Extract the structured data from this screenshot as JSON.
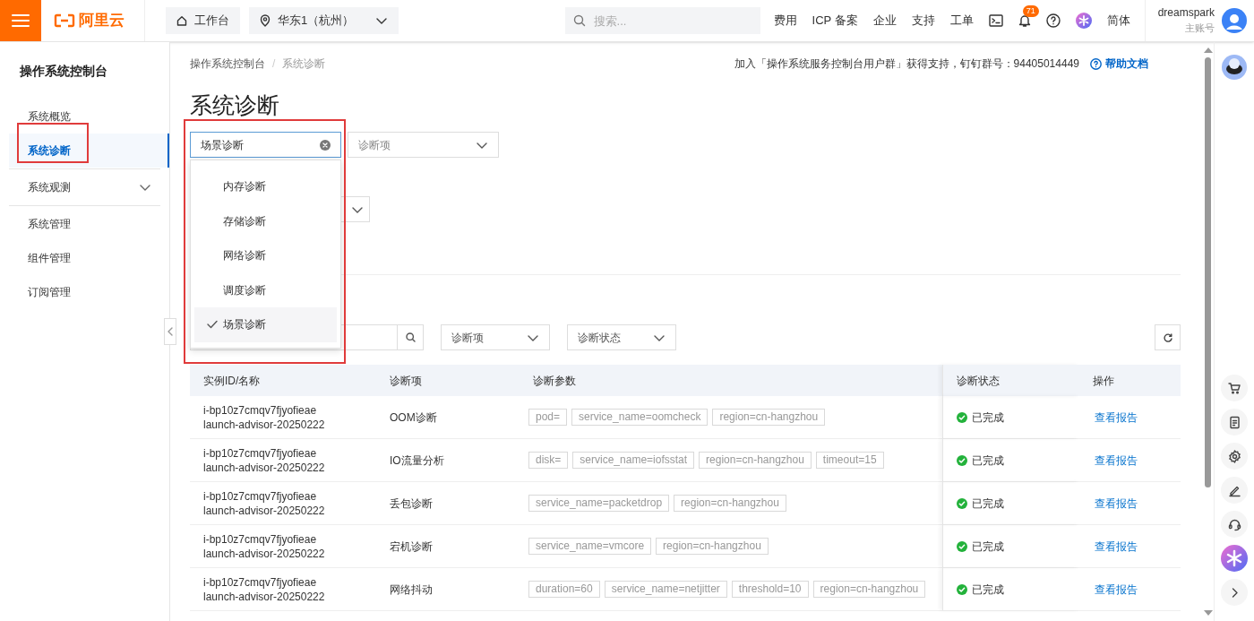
{
  "topbar": {
    "logo_text": "阿里云",
    "workbench": "工作台",
    "region": "华东1（杭州）",
    "search_placeholder": "搜索...",
    "links": [
      "费用",
      "ICP 备案",
      "企业",
      "支持",
      "工单"
    ],
    "notification_count": "71",
    "language": "简体",
    "user": {
      "name": "dreamspark",
      "role": "主账号"
    }
  },
  "sidebar": {
    "title": "操作系统控制台",
    "groups": [
      {
        "items": [
          {
            "label": "系统概览",
            "kind": "link",
            "selected": false
          },
          {
            "label": "系统诊断",
            "kind": "link",
            "selected": true
          }
        ]
      },
      {
        "items": [
          {
            "label": "系统观测",
            "kind": "group",
            "selected": false
          }
        ]
      },
      {
        "items": [
          {
            "label": "系统管理",
            "kind": "link",
            "selected": false
          },
          {
            "label": "组件管理",
            "kind": "link",
            "selected": false
          },
          {
            "label": "订阅管理",
            "kind": "link",
            "selected": false
          }
        ]
      }
    ]
  },
  "breadcrumb": [
    "操作系统控制台",
    "系统诊断"
  ],
  "breadcrumb_separator": "/",
  "notice": "加入「操作系统服务控制台用户群」获得支持，钉钉群号：94405014449",
  "help_link": "帮助文档",
  "page_title": "系统诊断",
  "filters": {
    "category": {
      "value": "场景诊断"
    },
    "item": {
      "placeholder": "诊断项"
    }
  },
  "dropdown": {
    "options": [
      {
        "label": "内存诊断",
        "selected": false
      },
      {
        "label": "存储诊断",
        "selected": false
      },
      {
        "label": "网络诊断",
        "selected": false
      },
      {
        "label": "调度诊断",
        "selected": false
      },
      {
        "label": "场景诊断",
        "selected": true
      }
    ]
  },
  "table_filters": {
    "item_select": {
      "placeholder": "诊断项"
    },
    "status_select": {
      "placeholder": "诊断状态"
    }
  },
  "table": {
    "columns": [
      "实例ID/名称",
      "诊断项",
      "诊断参数",
      "诊断状态",
      "操作"
    ],
    "rows": [
      {
        "instance_id": "i-bp10z7cmqv7fjyofieae",
        "instance_name": "launch-advisor-20250222",
        "item": "OOM诊断",
        "params": [
          "pod=",
          "service_name=oomcheck",
          "region=cn-hangzhou"
        ],
        "status": "已完成",
        "action": "查看报告"
      },
      {
        "instance_id": "i-bp10z7cmqv7fjyofieae",
        "instance_name": "launch-advisor-20250222",
        "item": "IO流量分析",
        "params": [
          "disk=",
          "service_name=iofsstat",
          "region=cn-hangzhou",
          "timeout=15"
        ],
        "status": "已完成",
        "action": "查看报告"
      },
      {
        "instance_id": "i-bp10z7cmqv7fjyofieae",
        "instance_name": "launch-advisor-20250222",
        "item": "丢包诊断",
        "params": [
          "service_name=packetdrop",
          "region=cn-hangzhou"
        ],
        "status": "已完成",
        "action": "查看报告"
      },
      {
        "instance_id": "i-bp10z7cmqv7fjyofieae",
        "instance_name": "launch-advisor-20250222",
        "item": "宕机诊断",
        "params": [
          "service_name=vmcore",
          "region=cn-hangzhou"
        ],
        "status": "已完成",
        "action": "查看报告"
      },
      {
        "instance_id": "i-bp10z7cmqv7fjyofieae",
        "instance_name": "launch-advisor-20250222",
        "item": "网络抖动",
        "params": [
          "duration=60",
          "service_name=netjitter",
          "threshold=10",
          "region=cn-hangzhou"
        ],
        "status": "已完成",
        "action": "查看报告"
      }
    ]
  }
}
